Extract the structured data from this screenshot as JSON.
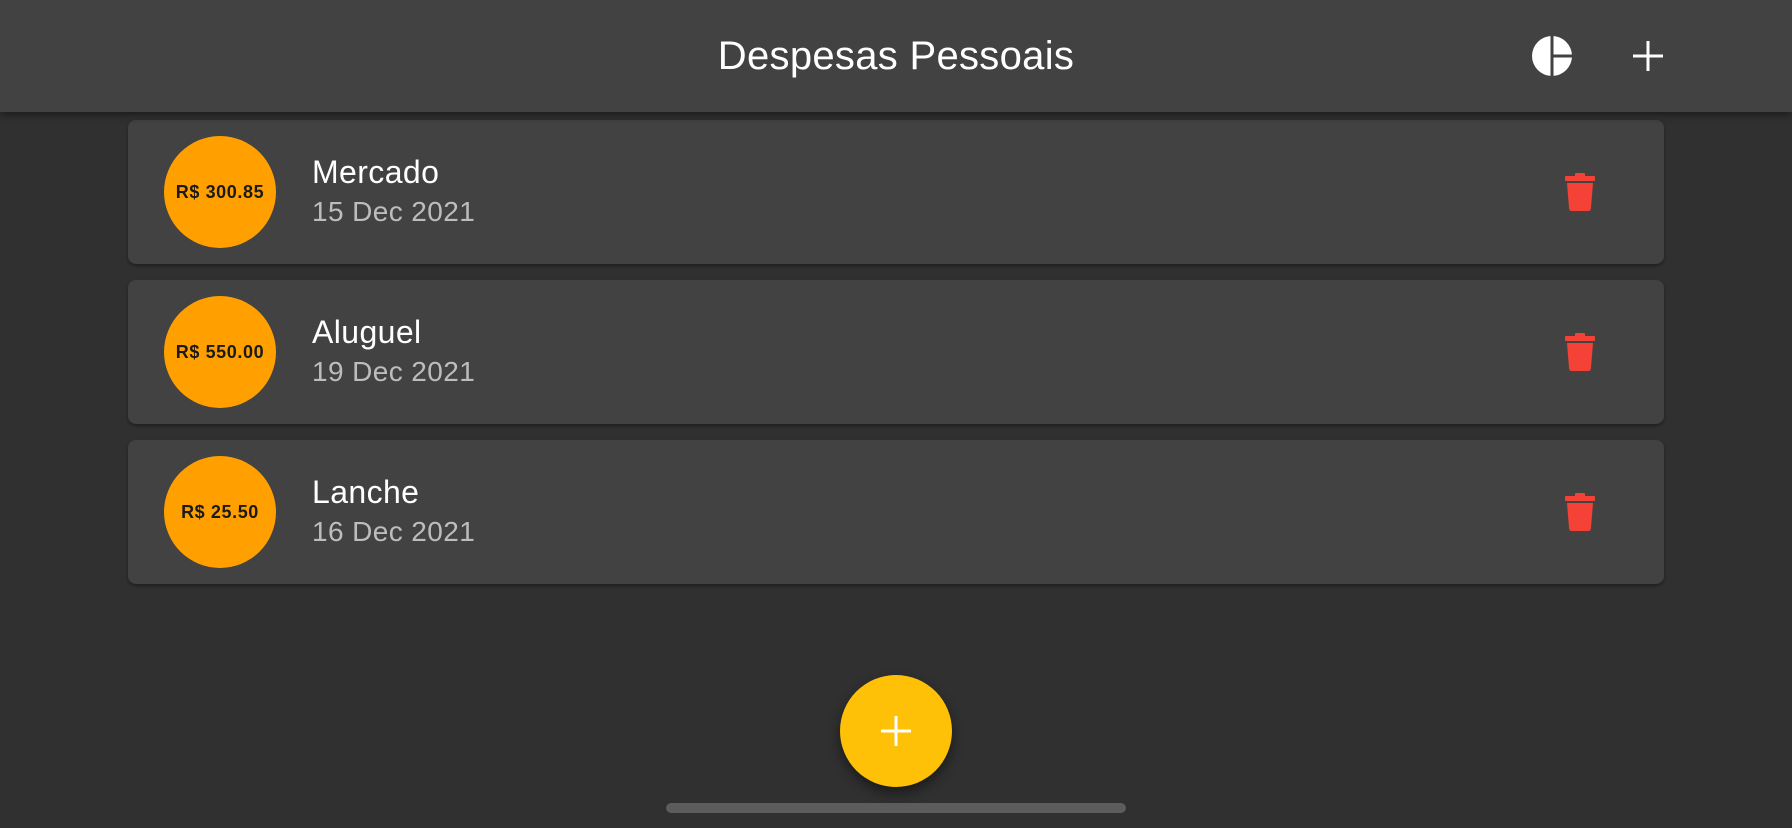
{
  "appbar": {
    "title": "Despesas Pessoais",
    "chart_icon": "pie-chart-icon",
    "add_icon": "plus-icon"
  },
  "transactions": [
    {
      "value": "R$ 300.85",
      "title": "Mercado",
      "date": "15 Dec 2021"
    },
    {
      "value": "R$ 550.00",
      "title": "Aluguel",
      "date": "19 Dec 2021"
    },
    {
      "value": "R$ 25.50",
      "title": "Lanche",
      "date": "16 Dec 2021"
    }
  ],
  "fab": {
    "icon": "plus-icon"
  },
  "colors": {
    "appbar": "#424242",
    "background": "#303030",
    "card": "#424242",
    "amount_circle": "#ff9f00",
    "delete": "#f44336",
    "fab": "#ffc107"
  }
}
